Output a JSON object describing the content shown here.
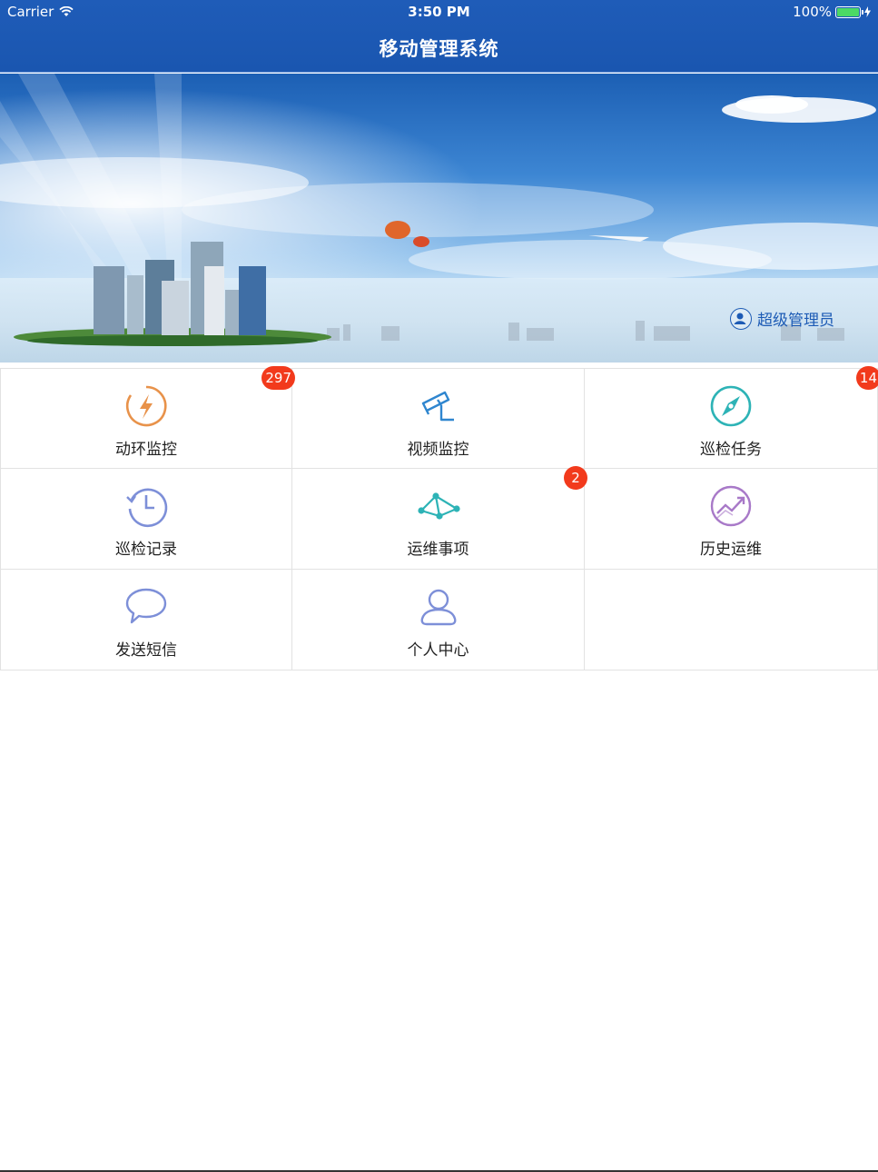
{
  "status_bar": {
    "carrier": "Carrier",
    "time": "3:50 PM",
    "battery": "100%"
  },
  "nav": {
    "title": "移动管理系统"
  },
  "banner": {
    "user_label": "超级管理员"
  },
  "colors": {
    "nav_bg": "#1f5cb8",
    "badge": "#f23a1c",
    "icon_orange": "#e8924a",
    "icon_blue": "#2f86cf",
    "icon_teal": "#2db3b6",
    "icon_periwinkle": "#7d8fd8",
    "icon_purple": "#a879c8"
  },
  "menu": [
    {
      "label": "动环监控",
      "icon": "lightning-icon",
      "badge": "297"
    },
    {
      "label": "视频监控",
      "icon": "camera-icon",
      "badge": ""
    },
    {
      "label": "巡检任务",
      "icon": "compass-icon",
      "badge": "14"
    },
    {
      "label": "巡检记录",
      "icon": "history-clock-icon",
      "badge": ""
    },
    {
      "label": "运维事项",
      "icon": "nodes-icon",
      "badge": "2"
    },
    {
      "label": "历史运维",
      "icon": "trend-icon",
      "badge": ""
    },
    {
      "label": "发送短信",
      "icon": "chat-bubble-icon",
      "badge": ""
    },
    {
      "label": "个人中心",
      "icon": "user-icon",
      "badge": ""
    }
  ]
}
